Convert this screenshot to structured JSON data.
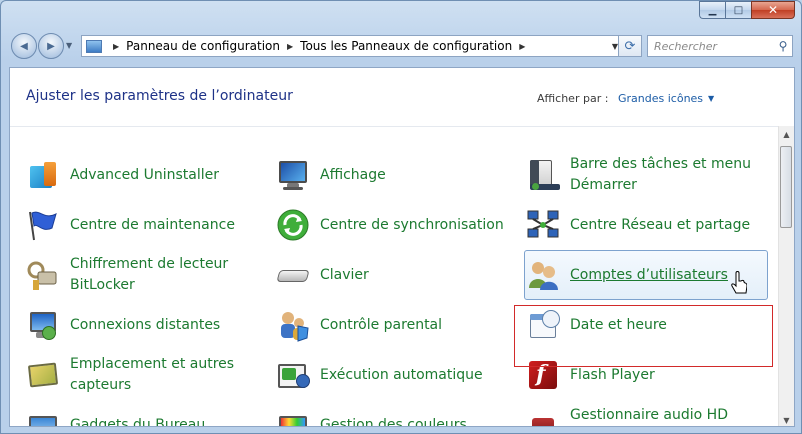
{
  "window": {
    "minimize_glyph": "▁",
    "maximize_glyph": "□",
    "close_glyph": "✕"
  },
  "nav": {
    "back_glyph": "◀",
    "forward_glyph": "▶",
    "recent_glyph": "▼",
    "breadcrumb": [
      "Panneau de configuration",
      "Tous les Panneaux de configuration"
    ],
    "separator": "▶",
    "dropdown_glyph": "▼",
    "refresh_glyph": "⟳",
    "search_placeholder": "Rechercher",
    "search_glyph": "⚲"
  },
  "header": {
    "title": "Ajuster les paramètres de l’ordinateur",
    "view_by_label": "Afficher par :",
    "view_by_value": "Grandes icônes",
    "view_by_arrow": "▼"
  },
  "items": [
    {
      "label": "Advanced Uninstaller",
      "icon": "advanced-uninstaller-icon"
    },
    {
      "label": "Affichage",
      "icon": "display-icon"
    },
    {
      "label": "Barre des tâches et menu Démarrer",
      "icon": "taskbar-start-menu-icon"
    },
    {
      "label": "Centre de maintenance",
      "icon": "action-center-flag-icon"
    },
    {
      "label": "Centre de synchronisation",
      "icon": "sync-center-icon"
    },
    {
      "label": "Centre Réseau et partage",
      "icon": "network-sharing-icon"
    },
    {
      "label": "Chiffrement de lecteur BitLocker",
      "icon": "bitlocker-icon"
    },
    {
      "label": "Clavier",
      "icon": "keyboard-icon"
    },
    {
      "label": "Comptes d’utilisateurs",
      "icon": "user-accounts-icon",
      "hovered": true
    },
    {
      "label": "Connexions distantes",
      "icon": "remote-connections-icon"
    },
    {
      "label": "Contrôle parental",
      "icon": "parental-controls-icon"
    },
    {
      "label": "Date et heure",
      "icon": "date-time-icon"
    },
    {
      "label": "Emplacement et autres capteurs",
      "icon": "location-sensors-icon"
    },
    {
      "label": "Exécution automatique",
      "icon": "autoplay-icon"
    },
    {
      "label": "Flash Player",
      "icon": "flash-player-icon"
    },
    {
      "label": "Gadgets du Bureau",
      "icon": "desktop-gadgets-icon"
    },
    {
      "label": "Gestion des couleurs",
      "icon": "color-management-icon"
    },
    {
      "label": "Gestionnaire audio HD",
      "icon": "hd-audio-manager-icon"
    }
  ],
  "scrollbar": {
    "up_glyph": "▲",
    "down_glyph": "▼"
  }
}
